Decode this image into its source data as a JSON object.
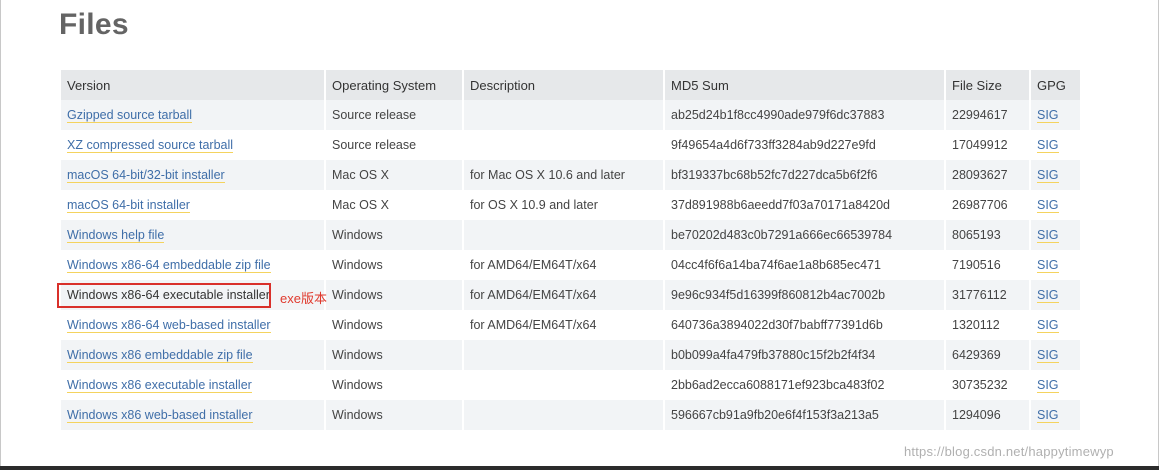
{
  "heading": "Files",
  "table": {
    "headers": [
      "Version",
      "Operating System",
      "Description",
      "MD5 Sum",
      "File Size",
      "GPG"
    ],
    "rows": [
      {
        "version": "Gzipped source tarball",
        "os": "Source release",
        "description": "",
        "md5": "ab25d24b1f8cc4990ade979f6dc37883",
        "size": "22994617",
        "gpg": "SIG"
      },
      {
        "version": "XZ compressed source tarball",
        "os": "Source release",
        "description": "",
        "md5": "9f49654a4d6f733ff3284ab9d227e9fd",
        "size": "17049912",
        "gpg": "SIG"
      },
      {
        "version": "macOS 64-bit/32-bit installer",
        "os": "Mac OS X",
        "description": "for Mac OS X 10.6 and later",
        "md5": "bf319337bc68b52fc7d227dca5b6f2f6",
        "size": "28093627",
        "gpg": "SIG"
      },
      {
        "version": "macOS 64-bit installer",
        "os": "Mac OS X",
        "description": "for OS X 10.9 and later",
        "md5": "37d891988b6aeedd7f03a70171a8420d",
        "size": "26987706",
        "gpg": "SIG"
      },
      {
        "version": "Windows help file",
        "os": "Windows",
        "description": "",
        "md5": "be70202d483c0b7291a666ec66539784",
        "size": "8065193",
        "gpg": "SIG"
      },
      {
        "version": "Windows x86-64 embeddable zip file",
        "os": "Windows",
        "description": "for AMD64/EM64T/x64",
        "md5": "04cc4f6f6a14ba74f6ae1a8b685ec471",
        "size": "7190516",
        "gpg": "SIG"
      },
      {
        "version": "Windows x86-64 executable installer",
        "os": "Windows",
        "description": "for AMD64/EM64T/x64",
        "md5": "9e96c934f5d16399f860812b4ac7002b",
        "size": "31776112",
        "gpg": "SIG"
      },
      {
        "version": "Windows x86-64 web-based installer",
        "os": "Windows",
        "description": "for AMD64/EM64T/x64",
        "md5": "640736a3894022d30f7babff77391d6b",
        "size": "1320112",
        "gpg": "SIG"
      },
      {
        "version": "Windows x86 embeddable zip file",
        "os": "Windows",
        "description": "",
        "md5": "b0b099a4fa479fb37880c15f2b2f4f34",
        "size": "6429369",
        "gpg": "SIG"
      },
      {
        "version": "Windows x86 executable installer",
        "os": "Windows",
        "description": "",
        "md5": "2bb6ad2ecca6088171ef923bca483f02",
        "size": "30735232",
        "gpg": "SIG"
      },
      {
        "version": "Windows x86 web-based installer",
        "os": "Windows",
        "description": "",
        "md5": "596667cb91a9fb20e6f4f153f3a213a5",
        "size": "1294096",
        "gpg": "SIG"
      }
    ]
  },
  "annotation": "exe版本",
  "watermark": "https://blog.csdn.net/happytimewyp",
  "colors": {
    "link": "#3f6ea8",
    "link_underline": "#f4d35e",
    "highlight": "#d9302a",
    "header_bg": "#e6e8ea",
    "row_alt_bg": "#f2f4f6"
  }
}
